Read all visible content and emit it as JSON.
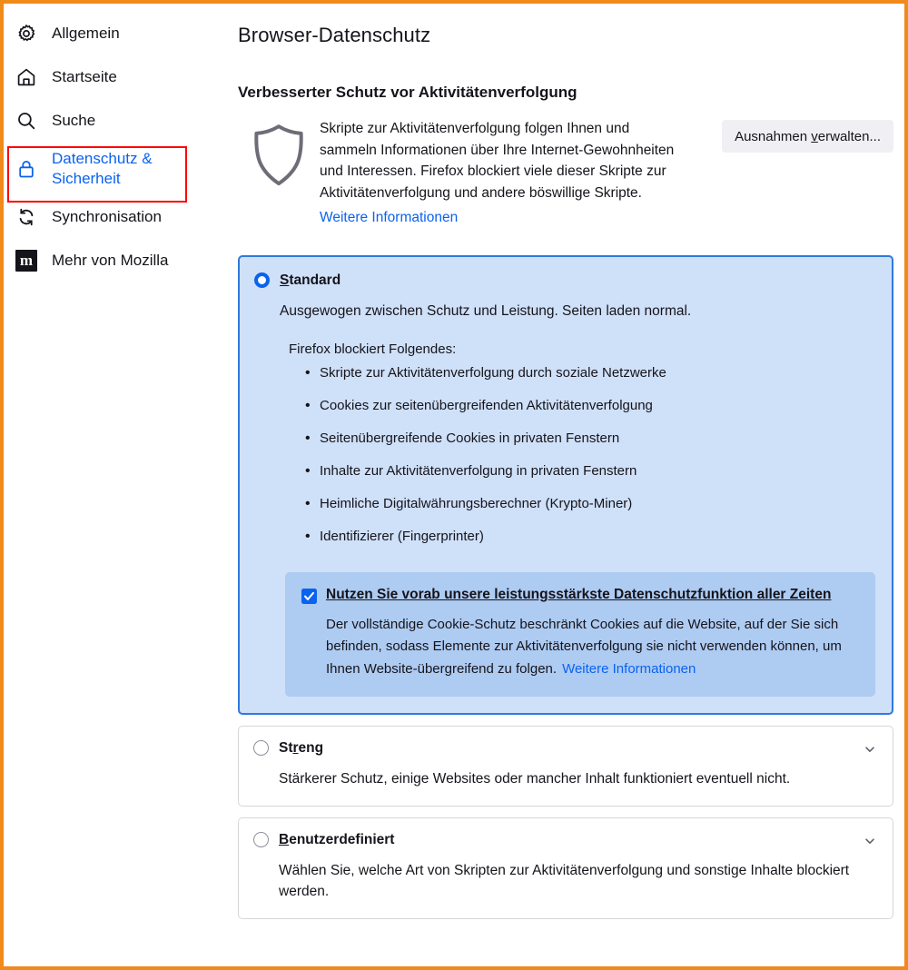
{
  "window": {
    "accent_border_color": "#f08a1a",
    "annotation_box_color": "#ff0000"
  },
  "sidebar": {
    "items": [
      {
        "label": "Allgemein",
        "icon": "gear-icon",
        "selected": false
      },
      {
        "label": "Startseite",
        "icon": "home-icon",
        "selected": false
      },
      {
        "label": "Suche",
        "icon": "search-icon",
        "selected": false
      },
      {
        "label": "Datenschutz &\nSicherheit",
        "icon": "lock-icon",
        "selected": true
      },
      {
        "label": "Synchronisation",
        "icon": "sync-icon",
        "selected": false
      },
      {
        "label": "Mehr von Mozilla",
        "icon": "mozilla-icon",
        "selected": false
      }
    ],
    "mozilla_badge_letter": "m",
    "selected_color": "#0a63ef"
  },
  "main": {
    "page_title": "Browser-Datenschutz",
    "section_title": "Verbesserter Schutz vor Aktivitätenverfolgung",
    "intro": {
      "icon": "shield-icon",
      "text": "Skripte zur Aktivitätenverfolgung folgen Ihnen und sammeln Informationen über Ihre Internet-Gewohnheiten und Interessen. Firefox blockiert viele dieser Skripte zur Aktivitätenverfolgung und andere böswillige Skripte.",
      "link_label": "Weitere Informationen"
    },
    "exceptions_button": {
      "prefix": "Ausnahmen ",
      "accesskey": "v",
      "suffix": "erwalten..."
    },
    "options": {
      "standard": {
        "accesskey": "S",
        "title_rest": "tandard",
        "selected": true,
        "description": "Ausgewogen zwischen Schutz und Leistung. Seiten laden normal.",
        "blocks_label": "Firefox blockiert Folgendes:",
        "blocked_items": [
          "Skripte zur Aktivitätenverfolgung durch soziale Netzwerke",
          "Cookies zur seitenübergreifenden Aktivitätenverfolgung",
          "Seitenübergreifende Cookies in privaten Fenstern",
          "Inhalte zur Aktivitätenverfolgung in privaten Fenstern",
          "Heimliche Digitalwährungsberechner (Krypto-Miner)",
          "Identifizierer (Fingerprinter)"
        ],
        "callout": {
          "checked": true,
          "title_accesskey": "N",
          "title_rest": "utzen Sie vorab unsere leistungsstärkste Datenschutzfunktion aller Zeiten",
          "body": "Der vollständige Cookie-Schutz beschränkt Cookies auf die Website, auf der Sie sich befinden, sodass Elemente zur Aktivitätenverfolgung sie nicht verwenden können, um Ihnen Website-übergreifend zu folgen.",
          "link_label": "Weitere Informationen"
        }
      },
      "strict": {
        "title_prefix": "St",
        "accesskey": "r",
        "title_rest": "eng",
        "selected": false,
        "description": "Stärkerer Schutz, einige Websites oder mancher Inhalt funktioniert eventuell nicht.",
        "expander_icon": "chevron-down-icon"
      },
      "custom": {
        "accesskey": "B",
        "title_rest": "enutzerdefiniert",
        "selected": false,
        "description": "Wählen Sie, welche Art von Skripten zur Aktivitätenverfolgung und sonstige Inhalte blockiert werden.",
        "expander_icon": "chevron-down-icon"
      }
    }
  }
}
